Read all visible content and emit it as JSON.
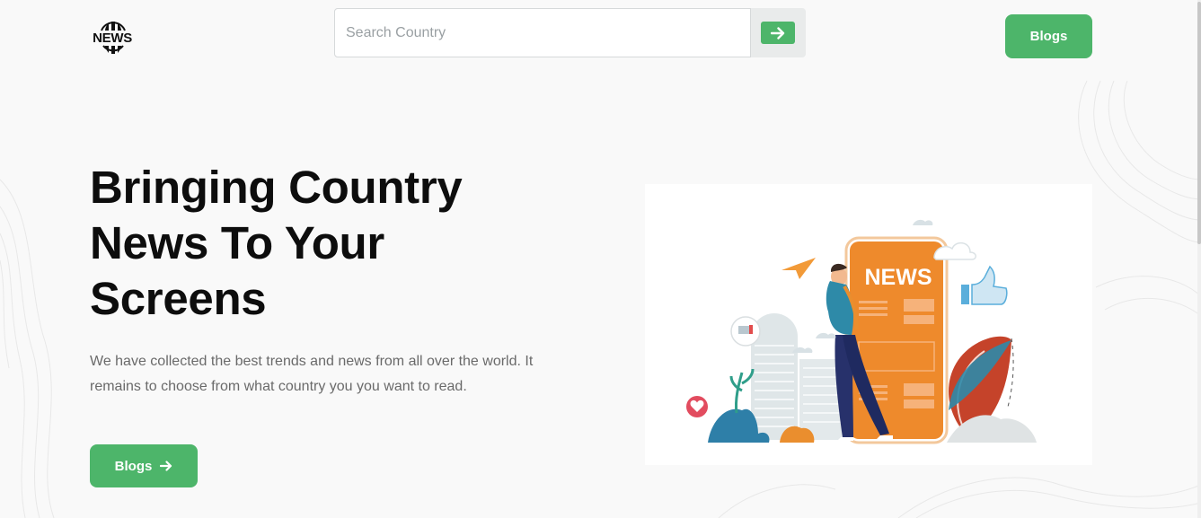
{
  "header": {
    "logo_text": "NEWS",
    "search": {
      "placeholder": "Search Country",
      "value": ""
    },
    "nav_blogs_label": "Blogs"
  },
  "hero": {
    "title": "Bringing Country News To Your Screens",
    "description": "We have collected the best trends and news from all over the world. It remains to choose from what country you you want to read.",
    "cta_label": "Blogs"
  },
  "illustration": {
    "phone_text": "NEWS"
  },
  "colors": {
    "accent": "#4db56a",
    "phone_orange": "#ee8a2c",
    "background": "#f9f9f9"
  },
  "icons": [
    "globe-icon",
    "arrow-right-icon"
  ]
}
